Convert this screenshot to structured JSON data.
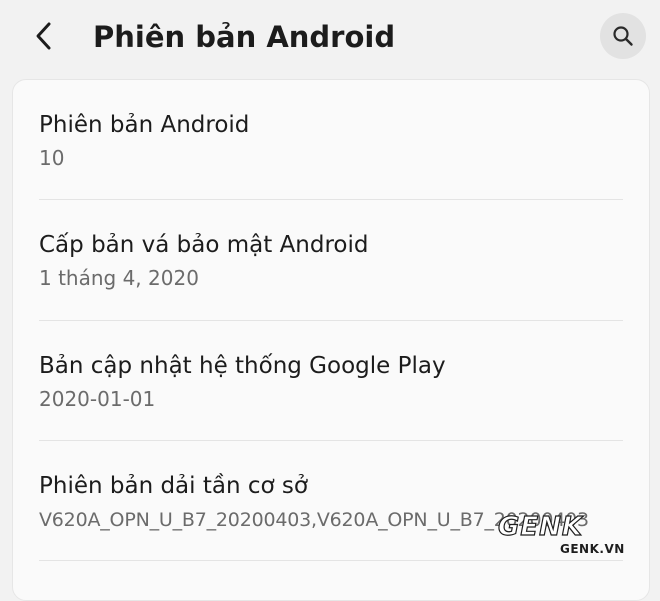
{
  "header": {
    "title": "Phiên bản Android",
    "back_icon": "chevron-left-icon",
    "search_icon": "search-icon"
  },
  "items": [
    {
      "title": "Phiên bản Android",
      "value": "10"
    },
    {
      "title": "Cấp bản vá bảo mật Android",
      "value": "1 tháng 4, 2020"
    },
    {
      "title": "Bản cập nhật hệ thống Google Play",
      "value": "2020-01-01"
    },
    {
      "title": "Phiên bản dải tần cơ sở",
      "value": "V620A_OPN_U_B7_20200403,V620A_OPN_U_B7_20200403"
    }
  ],
  "watermark": {
    "logo": "GENK",
    "site": "GENK.VN"
  },
  "colors": {
    "background": "#f2f2f2",
    "card": "#fafafa",
    "primary_text": "#1c1c1c",
    "secondary_text": "#6b6b6b",
    "search_button": "#e2e2e2"
  }
}
